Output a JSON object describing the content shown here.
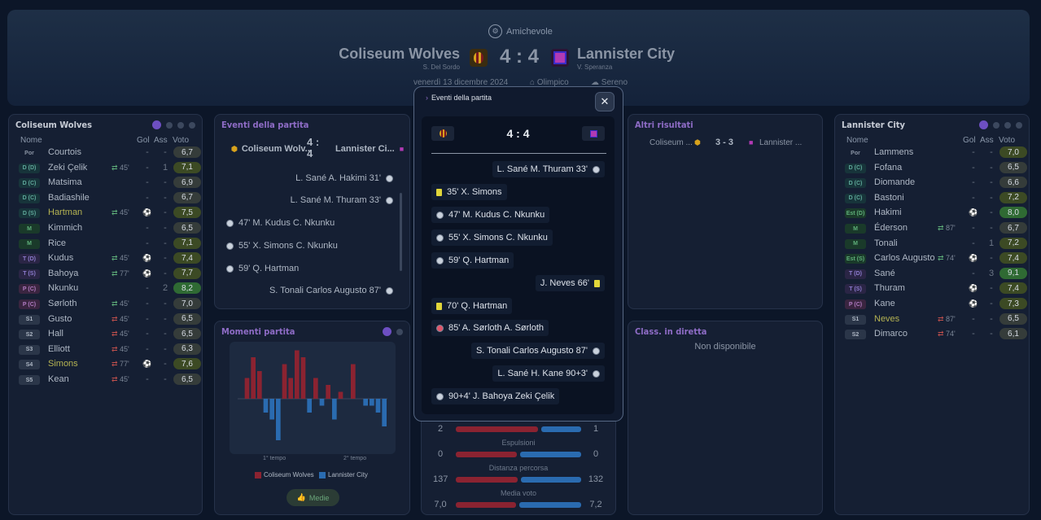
{
  "header": {
    "competition": "Amichevole",
    "home_team": "Coliseum Wolves",
    "away_team": "Lannister City",
    "home_coach": "S. Del Sordo",
    "away_coach": "V. Speranza",
    "score": "4 : 4",
    "date": "venerdì 13 dicembre 2024",
    "stadium": "Olimpico",
    "weather": "Sereno"
  },
  "home_panel": {
    "title": "Coliseum Wolves",
    "col_name": "Nome",
    "col_gol": "Gol",
    "col_ass": "Ass",
    "col_vote": "Voto",
    "players": [
      {
        "pos": "Por",
        "name": "Courtois",
        "sub": "",
        "gol": "-",
        "ass": "-",
        "vote": "6,7",
        "vclass": "n",
        "hl": false,
        "ev": ""
      },
      {
        "pos": "D (D)",
        "name": "Zeki Çelik",
        "sub": "45'",
        "subdir": "out",
        "gol": "-",
        "ass": "1",
        "vote": "7,1",
        "vclass": "g",
        "hl": false,
        "ev": ""
      },
      {
        "pos": "D (C)",
        "name": "Matsima",
        "sub": "",
        "gol": "-",
        "ass": "-",
        "vote": "6,9",
        "vclass": "n",
        "hl": false,
        "ev": ""
      },
      {
        "pos": "D (C)",
        "name": "Badiashile",
        "sub": "",
        "gol": "-",
        "ass": "-",
        "vote": "6,7",
        "vclass": "n",
        "hl": false,
        "ev": ""
      },
      {
        "pos": "D (S)",
        "name": "Hartman",
        "sub": "45'",
        "subdir": "out",
        "gol": "",
        "ass": "-",
        "vote": "7,5",
        "vclass": "g",
        "hl": true,
        "ev": "ball"
      },
      {
        "pos": "M",
        "name": "Kimmich",
        "sub": "",
        "gol": "-",
        "ass": "-",
        "vote": "6,5",
        "vclass": "n",
        "hl": false,
        "ev": ""
      },
      {
        "pos": "M",
        "name": "Rice",
        "sub": "",
        "gol": "-",
        "ass": "-",
        "vote": "7,1",
        "vclass": "g",
        "hl": false,
        "ev": ""
      },
      {
        "pos": "T (D)",
        "name": "Kudus",
        "sub": "45'",
        "subdir": "out",
        "gol": "",
        "ass": "-",
        "vote": "7,4",
        "vclass": "g",
        "hl": false,
        "ev": "ball"
      },
      {
        "pos": "T (S)",
        "name": "Bahoya",
        "sub": "77'",
        "subdir": "out",
        "gol": "",
        "ass": "-",
        "vote": "7,7",
        "vclass": "g",
        "hl": false,
        "ev": "ball"
      },
      {
        "pos": "P (C)",
        "name": "Nkunku",
        "sub": "",
        "gol": "-",
        "ass": "2",
        "vote": "8,2",
        "vclass": "gg",
        "hl": false,
        "ev": ""
      },
      {
        "pos": "P (C)",
        "name": "Sørloth",
        "sub": "45'",
        "subdir": "out",
        "gol": "-",
        "ass": "-",
        "vote": "7,0",
        "vclass": "n",
        "hl": false,
        "ev": ""
      },
      {
        "pos": "S1",
        "name": "Gusto",
        "sub": "45'",
        "subdir": "in",
        "gol": "-",
        "ass": "-",
        "vote": "6,5",
        "vclass": "n",
        "hl": false,
        "ev": ""
      },
      {
        "pos": "S2",
        "name": "Hall",
        "sub": "45'",
        "subdir": "in",
        "gol": "-",
        "ass": "-",
        "vote": "6,5",
        "vclass": "n",
        "hl": false,
        "ev": ""
      },
      {
        "pos": "S3",
        "name": "Elliott",
        "sub": "45'",
        "subdir": "in",
        "gol": "-",
        "ass": "-",
        "vote": "6,3",
        "vclass": "n",
        "hl": false,
        "ev": ""
      },
      {
        "pos": "S4",
        "name": "Simons",
        "sub": "77'",
        "subdir": "in",
        "gol": "",
        "ass": "-",
        "vote": "7,6",
        "vclass": "g",
        "hl": true,
        "ev": "ball"
      },
      {
        "pos": "S5",
        "name": "Kean",
        "sub": "45'",
        "subdir": "in",
        "gol": "-",
        "ass": "-",
        "vote": "6,5",
        "vclass": "n",
        "hl": false,
        "ev": ""
      }
    ]
  },
  "away_panel": {
    "title": "Lannister City",
    "col_name": "Nome",
    "col_gol": "Gol",
    "col_ass": "Ass",
    "col_vote": "Voto",
    "players": [
      {
        "pos": "Por",
        "name": "Lammens",
        "sub": "",
        "gol": "-",
        "ass": "-",
        "vote": "7,0",
        "vclass": "g",
        "hl": false,
        "ev": ""
      },
      {
        "pos": "D (C)",
        "name": "Fofana",
        "sub": "",
        "gol": "-",
        "ass": "-",
        "vote": "6,5",
        "vclass": "n",
        "hl": false,
        "ev": ""
      },
      {
        "pos": "D (C)",
        "name": "Diomande",
        "sub": "",
        "gol": "-",
        "ass": "-",
        "vote": "6,6",
        "vclass": "n",
        "hl": false,
        "ev": ""
      },
      {
        "pos": "D (C)",
        "name": "Bastoni",
        "sub": "",
        "gol": "-",
        "ass": "-",
        "vote": "7,2",
        "vclass": "g",
        "hl": false,
        "ev": ""
      },
      {
        "pos": "Est (D)",
        "name": "Hakimi",
        "sub": "",
        "gol": "",
        "ass": "-",
        "vote": "8,0",
        "vclass": "gg",
        "hl": false,
        "ev": "ball"
      },
      {
        "pos": "M",
        "name": "Éderson",
        "sub": "87'",
        "subdir": "out",
        "gol": "-",
        "ass": "-",
        "vote": "6,7",
        "vclass": "n",
        "hl": false,
        "ev": ""
      },
      {
        "pos": "M",
        "name": "Tonali",
        "sub": "",
        "gol": "-",
        "ass": "1",
        "vote": "7,2",
        "vclass": "g",
        "hl": false,
        "ev": ""
      },
      {
        "pos": "Est (S)",
        "name": "Carlos Augusto",
        "sub": "74'",
        "subdir": "out",
        "gol": "",
        "ass": "-",
        "vote": "7,4",
        "vclass": "g",
        "hl": false,
        "ev": "ball"
      },
      {
        "pos": "T (D)",
        "name": "Sané",
        "sub": "",
        "gol": "-",
        "ass": "3",
        "vote": "9,1",
        "vclass": "gg",
        "hl": false,
        "ev": ""
      },
      {
        "pos": "T (S)",
        "name": "Thuram",
        "sub": "",
        "gol": "",
        "ass": "-",
        "vote": "7,4",
        "vclass": "g",
        "hl": false,
        "ev": "ball"
      },
      {
        "pos": "P (C)",
        "name": "Kane",
        "sub": "",
        "gol": "",
        "ass": "-",
        "vote": "7,3",
        "vclass": "g",
        "hl": false,
        "ev": "ball"
      },
      {
        "pos": "S1",
        "name": "Neves",
        "sub": "87'",
        "subdir": "in",
        "gol": "-",
        "ass": "-",
        "vote": "6,5",
        "vclass": "n",
        "hl": true,
        "ev": ""
      },
      {
        "pos": "S2",
        "name": "Dimarco",
        "sub": "74'",
        "subdir": "in",
        "gol": "-",
        "ass": "-",
        "vote": "6,1",
        "vclass": "n",
        "hl": false,
        "ev": ""
      }
    ]
  },
  "events_panel": {
    "title": "Eventi della partita",
    "home": "Coliseum Wolv...",
    "away": "Lannister Ci...",
    "score_top": "4 :",
    "score_bottom": "4",
    "events": [
      {
        "side": "right",
        "text": "L. Sané A. Hakimi 31'",
        "type": "ball"
      },
      {
        "side": "right",
        "text": "L. Sané M. Thuram 33'",
        "type": "ball"
      },
      {
        "side": "left",
        "text": "47' M. Kudus C. Nkunku",
        "type": "ball"
      },
      {
        "side": "left",
        "text": "55' X. Simons C. Nkunku",
        "type": "ball"
      },
      {
        "side": "left",
        "text": "59' Q. Hartman",
        "type": "ball"
      },
      {
        "side": "right",
        "text": "S. Tonali Carlos Augusto 87'",
        "type": "ball"
      }
    ]
  },
  "momentum": {
    "title": "Momenti partita",
    "xlabel1": "1° tempo",
    "xlabel2": "2° tempo",
    "legend_home": "Coliseum Wolves",
    "legend_away": "Lannister City",
    "button": "Medie",
    "home_color": "#8b2331",
    "away_color": "#2a6bb0"
  },
  "chart_data": {
    "type": "bar",
    "title": "Momenti partita",
    "series": [
      {
        "name": "Coliseum Wolves",
        "values": [
          0,
          3,
          6,
          4,
          0,
          0,
          0,
          5,
          3,
          7,
          6,
          0,
          3,
          0,
          2,
          0,
          1,
          0,
          5,
          0,
          0,
          0,
          0,
          0
        ]
      },
      {
        "name": "Lannister City",
        "values": [
          0,
          0,
          0,
          0,
          2,
          3,
          6,
          0,
          0,
          0,
          0,
          2,
          0,
          1,
          0,
          3,
          0,
          0,
          0,
          0,
          1,
          1,
          2,
          4
        ]
      }
    ]
  },
  "other_results": {
    "title": "Altri risultati",
    "home": "Coliseum ...",
    "away": "Lannister ...",
    "score": "3 - 3"
  },
  "live_table": {
    "title": "Class. in diretta",
    "empty": "Non disponibile"
  },
  "stats": [
    {
      "home": "2",
      "away": "1",
      "label": "Espulsioni",
      "hv": 2,
      "av": 1
    },
    {
      "home": "0",
      "away": "0",
      "label": "Distanza percorsa",
      "hv": 1,
      "av": 1
    },
    {
      "home": "137",
      "away": "132",
      "label": "Media voto",
      "hv": 137,
      "av": 132
    },
    {
      "home": "7,0",
      "away": "7,2",
      "label": "",
      "hv": 7.0,
      "av": 7.2
    }
  ],
  "modal": {
    "title": "Eventi della partita",
    "score": "4 : 4",
    "events": [
      {
        "side": "right",
        "text": "L. Sané M. Thuram 33'",
        "type": "ball"
      },
      {
        "side": "left",
        "text": "35' X. Simons",
        "type": "yellow"
      },
      {
        "side": "left",
        "text": "47' M. Kudus C. Nkunku",
        "type": "ball"
      },
      {
        "side": "left",
        "text": "55' X. Simons C. Nkunku",
        "type": "ball"
      },
      {
        "side": "left",
        "text": "59' Q. Hartman",
        "type": "ball"
      },
      {
        "side": "right",
        "text": "J. Neves 66'",
        "type": "yellow"
      },
      {
        "side": "left",
        "text": "70' Q. Hartman",
        "type": "yellow"
      },
      {
        "side": "left",
        "text": "85' A. Sørloth A. Sørloth",
        "type": "owngoal"
      },
      {
        "side": "right",
        "text": "S. Tonali Carlos Augusto 87'",
        "type": "ball"
      },
      {
        "side": "right",
        "text": "L. Sané H. Kane 90+3'",
        "type": "ball"
      },
      {
        "side": "left",
        "text": "90+4' J. Bahoya Zeki Çelik",
        "type": "ball"
      }
    ]
  }
}
